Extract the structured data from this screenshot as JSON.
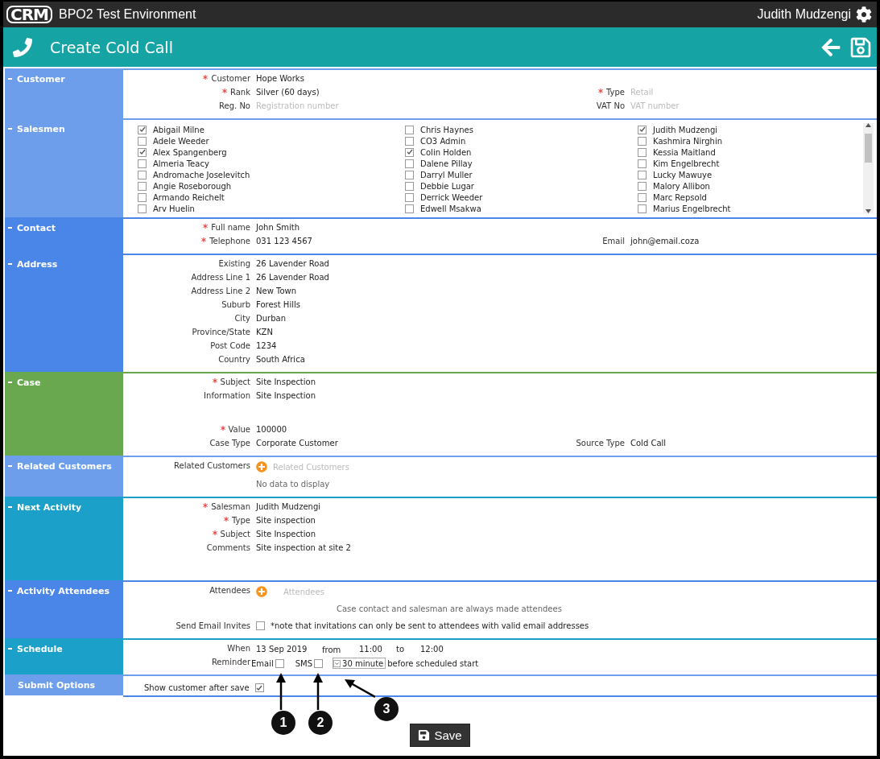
{
  "app": {
    "logo": "CRM",
    "environment": "BPO2 Test Environment",
    "user": "Judith Mudzengi"
  },
  "header": {
    "title": "Create Cold Call"
  },
  "sections": [
    {
      "title": "Customer",
      "color": "#6d9eeb",
      "collapsible": true,
      "kind": "fields",
      "rows": [
        {
          "label": "Customer",
          "required": true,
          "value": "Hope Works"
        },
        {
          "label": "Rank",
          "required": true,
          "value": "Silver (60 days)",
          "right": {
            "label": "Type",
            "required": true,
            "placeholder": "Retail"
          }
        },
        {
          "label": "Reg. No",
          "required": false,
          "placeholder": "Registration number",
          "right": {
            "label": "VAT No",
            "required": false,
            "placeholder": "VAT number"
          }
        }
      ]
    },
    {
      "title": "Salesmen",
      "color": "#6d9eeb",
      "collapsible": true,
      "kind": "salesmen",
      "salesmen": [
        {
          "name": "Abigail Milne",
          "checked": true
        },
        {
          "name": "Adele Weeder",
          "checked": false
        },
        {
          "name": "Alex Spangenberg",
          "checked": true
        },
        {
          "name": "Almeria Teacy",
          "checked": false
        },
        {
          "name": "Andromache Joselevitch",
          "checked": false
        },
        {
          "name": "Angie Roseborough",
          "checked": false
        },
        {
          "name": "Armando Reichelt",
          "checked": false
        },
        {
          "name": "Arv Huelin",
          "checked": false
        },
        {
          "name": "Chris Haynes",
          "checked": false
        },
        {
          "name": "CO3 Admin",
          "checked": false
        },
        {
          "name": "Colin Holden",
          "checked": true
        },
        {
          "name": "Dalene Pillay",
          "checked": false
        },
        {
          "name": "Darryl Muller",
          "checked": false
        },
        {
          "name": "Debbie Lugar",
          "checked": false
        },
        {
          "name": "Derrick Weeder",
          "checked": false
        },
        {
          "name": "Edwell Msakwa",
          "checked": false
        },
        {
          "name": "Judith Mudzengi",
          "checked": true
        },
        {
          "name": "Kashmira Nirghin",
          "checked": false
        },
        {
          "name": "Kessia Maitland",
          "checked": false
        },
        {
          "name": "Kim Engelbrecht",
          "checked": false
        },
        {
          "name": "Lucky Mawuye",
          "checked": false
        },
        {
          "name": "Malory Allibon",
          "checked": false
        },
        {
          "name": "Marc Repsold",
          "checked": false
        },
        {
          "name": "Marius Engelbrecht",
          "checked": false
        }
      ]
    },
    {
      "title": "Contact",
      "color": "#4a86e8",
      "collapsible": true,
      "kind": "fields",
      "rows": [
        {
          "label": "Full name",
          "required": true,
          "value": "John Smith"
        },
        {
          "label": "Telephone",
          "required": true,
          "value": "031 123 4567",
          "right": {
            "label": "Email",
            "required": false,
            "value": "john@email.coza"
          }
        }
      ]
    },
    {
      "title": "Address",
      "color": "#4a86e8",
      "collapsible": true,
      "kind": "fields",
      "rows": [
        {
          "label": "Existing",
          "required": false,
          "value": "26 Lavender Road"
        },
        {
          "label": "Address Line 1",
          "required": false,
          "value": "26 Lavender Road"
        },
        {
          "label": "Address Line 2",
          "required": false,
          "value": "New Town"
        },
        {
          "label": "Suburb",
          "required": false,
          "value": "Forest Hills"
        },
        {
          "label": "City",
          "required": false,
          "value": "Durban"
        },
        {
          "label": "Province/State",
          "required": false,
          "value": "KZN"
        },
        {
          "label": "Post Code",
          "required": false,
          "value": "1234"
        },
        {
          "label": "Country",
          "required": false,
          "value": "South Africa"
        }
      ]
    },
    {
      "title": "Case",
      "color": "#6aa84f",
      "collapsible": true,
      "kind": "fields",
      "rows": [
        {
          "label": "Subject",
          "required": true,
          "value": "Site Inspection"
        },
        {
          "label": "Information",
          "required": false,
          "value": "Site Inspection",
          "multiline": true
        },
        {
          "label": "Value",
          "required": true,
          "value": "100000"
        },
        {
          "label": "Case Type",
          "required": false,
          "value": "Corporate Customer",
          "right": {
            "label": "Source Type",
            "required": false,
            "value": "Cold Call"
          }
        }
      ]
    },
    {
      "title": "Related Customers",
      "color": "#6d9eeb",
      "collapsible": true,
      "kind": "related",
      "label": "Related Customers",
      "placeholder": "Related Customers",
      "empty_text": "No data to display"
    },
    {
      "title": "Next Activity",
      "color": "#1ba1c9",
      "collapsible": true,
      "kind": "fields",
      "rows": [
        {
          "label": "Salesman",
          "required": true,
          "value": "Judith Mudzengi"
        },
        {
          "label": "Type",
          "required": true,
          "value": "Site inspection"
        },
        {
          "label": "Subject",
          "required": true,
          "value": "Site Inspection"
        },
        {
          "label": "Comments",
          "required": false,
          "value": "Site inspection at site 2",
          "multiline": true
        }
      ]
    },
    {
      "title": "Activity Attendees",
      "color": "#4a86e8",
      "collapsible": true,
      "kind": "attendees",
      "label": "Attendees",
      "placeholder": "Attendees",
      "note": "Case contact and salesman are always made attendees",
      "invite_label": "Send Email Invites",
      "invite_checked": false,
      "invite_note": "*note that invitations can only be sent to attendees with valid email addresses"
    },
    {
      "title": "Schedule",
      "color": "#1ba1c9",
      "collapsible": true,
      "kind": "schedule",
      "when_label": "When",
      "date": "13 Sep 2019",
      "from_label": "from",
      "from": "11:00",
      "to_label": "to",
      "to": "12:00",
      "reminder_label": "Reminder",
      "email_label": "Email",
      "email_checked": false,
      "sms_label": "SMS",
      "sms_checked": false,
      "interval": "30 minute",
      "after_text": "before scheduled start"
    },
    {
      "title": "Submit Options",
      "color": "#6d9eeb",
      "collapsible": false,
      "kind": "submit",
      "label": "Show customer after save",
      "checked": true
    }
  ],
  "save_button": "Save",
  "callouts": [
    "1",
    "2",
    "3"
  ]
}
